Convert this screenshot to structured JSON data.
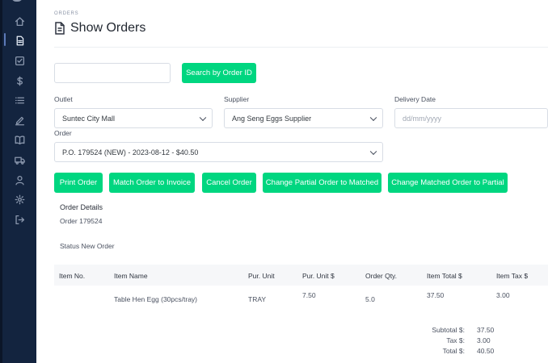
{
  "breadcrumb": "ORDERS",
  "page_title": "Show Orders",
  "search": {
    "value": "",
    "button_label": "Search by Order ID"
  },
  "filters": {
    "outlet_label": "Outlet",
    "outlet_value": "Suntec City Mall",
    "supplier_label": "Supplier",
    "supplier_value": "Ang Seng Eggs Supplier",
    "delivery_label": "Delivery Date",
    "delivery_placeholder": "dd/mm/yyyy",
    "order_label": "Order",
    "order_value": "P.O. 179524 (NEW) - 2023-08-12 - $40.50"
  },
  "actions": [
    "Print Order",
    "Match Order to Invoice",
    "Cancel Order",
    "Change Partial Order to Matched",
    "Change Matched Order to Partial"
  ],
  "details": {
    "heading": "Order Details",
    "order_line": "Order 179524",
    "status_line": "Status New Order"
  },
  "table": {
    "headers": [
      "Item No.",
      "Item Name",
      "Pur. Unit",
      "Pur. Unit $",
      "Order Qty.",
      "Item Total $",
      "Item Tax $"
    ],
    "rows": [
      {
        "item_no": "",
        "item_name": "Table Hen Egg (30pcs/tray)",
        "unit": "TRAY",
        "unit_price": "7.50",
        "qty": "5.0",
        "total": "37.50",
        "tax": "3.00"
      }
    ]
  },
  "summary": {
    "subtotal_label": "Subtotal $:",
    "subtotal": "37.50",
    "tax_label": "Tax $:",
    "tax": "3.00",
    "total_label": "Total $:",
    "total": "40.50"
  },
  "sidebar_icons": [
    "home-icon",
    "document-icon",
    "checkbox-icon",
    "dollar-icon",
    "list-icon",
    "edit-icon",
    "book-icon",
    "truck-icon",
    "user-icon",
    "gear-icon",
    "logout-icon"
  ],
  "colors": {
    "sidebar": "#13243f",
    "accent": "#00d680"
  }
}
